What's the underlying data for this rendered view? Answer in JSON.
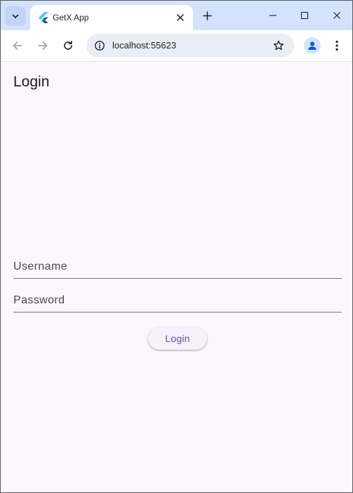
{
  "browser": {
    "tab": {
      "title": "GetX App",
      "favicon": "flutter-logo-icon"
    },
    "address_bar": {
      "url": "localhost:55623"
    },
    "colors": {
      "tabstrip": "#d3e3fd",
      "toolbar": "#ffffff",
      "omnibox": "#e9eef6"
    }
  },
  "app": {
    "title": "Login",
    "form": {
      "username_placeholder": "Username",
      "password_placeholder": "Password",
      "login_button_label": "Login"
    },
    "colors": {
      "background": "#fcf6fd",
      "primary": "#6750a4",
      "underline": "#79747e"
    }
  }
}
